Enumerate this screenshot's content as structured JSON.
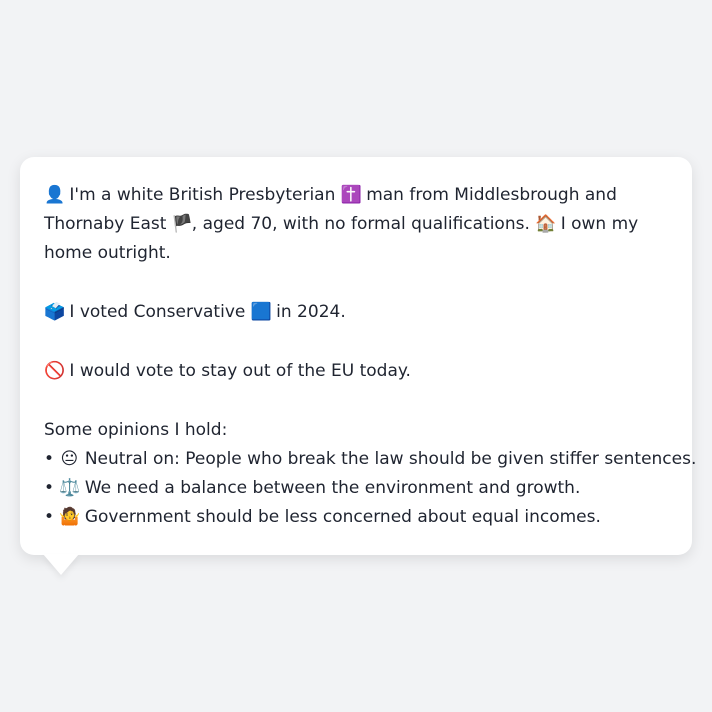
{
  "persona": {
    "intro": {
      "icon": "👤",
      "text_1": "I'm a white British Presbyterian",
      "icon_religion": "✝️",
      "text_2": "man from Middlesbrough and Thornaby East",
      "icon_flag": "🏴",
      "text_3": ", aged 70, with no formal qualifications.",
      "icon_home": "🏠",
      "text_4": "I own my home outright."
    },
    "vote": {
      "icon": "🗳️",
      "text_1": "I voted Conservative",
      "icon_party": "🟦",
      "text_2": "in 2024."
    },
    "eu": {
      "icon": "🚫",
      "text": "I would vote to stay out of the EU today."
    },
    "opinions": {
      "heading": "Some opinions I hold:",
      "items": [
        {
          "bullet": "•",
          "icon": "😐",
          "text": "Neutral on: People who break the law should be given stiffer sentences."
        },
        {
          "bullet": "•",
          "icon": "⚖️",
          "text": "We need a balance between the environment and growth."
        },
        {
          "bullet": "•",
          "icon": "🤷",
          "text": "Government should be less concerned about equal incomes."
        }
      ]
    }
  }
}
